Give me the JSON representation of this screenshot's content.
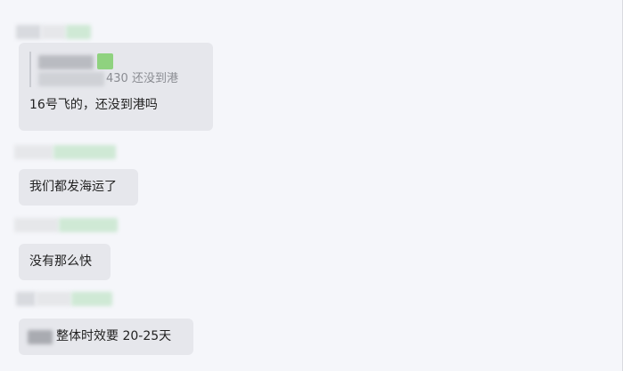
{
  "messages": [
    {
      "quoted_text_suffix": "430  还没到港",
      "text": "16号飞的，还没到港吗"
    },
    {
      "text": "我们都发海运了"
    },
    {
      "text": "没有那么快"
    },
    {
      "text": "整体时效要 20-25天"
    }
  ],
  "colors": {
    "background": "#f5f6fa",
    "bubble": "#e6e7ec",
    "quote_text": "#8a8c92"
  }
}
